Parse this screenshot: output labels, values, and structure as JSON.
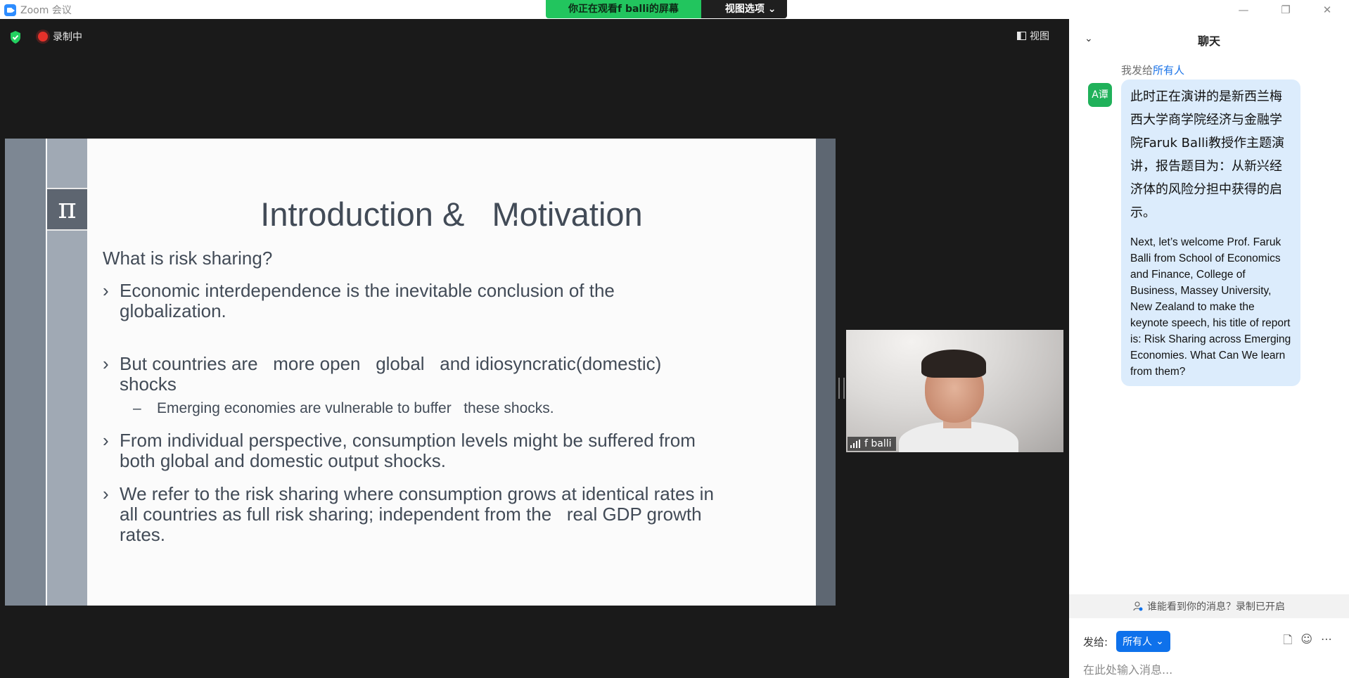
{
  "window": {
    "title": "Zoom 会议"
  },
  "share_banner": {
    "status": "你正在观看f balli的屏幕",
    "view_options": "视图选项"
  },
  "toolbar": {
    "recording": "录制中",
    "view": "视图"
  },
  "slide": {
    "title": "Introduction &   Motivation",
    "question": "What is risk sharing?",
    "bullets": [
      "Economic interdependence is the inevitable conclusion of the\nglobalization.",
      "But countries are   more open   global   and idiosyncratic(domestic)\nshocks",
      "From individual perspective, consumption levels might be suffered from\nboth global and domestic output shocks.",
      "We refer to the risk sharing where consumption grows at identical rates in\nall countries as full risk sharing; independent from the   real GDP growth\nrates."
    ],
    "sub_bullet": "Emerging economies are vulnerable to buffer   these shocks."
  },
  "video": {
    "participant_name": "f balli"
  },
  "chat": {
    "title": "聊天",
    "meta_prefix": "我发给",
    "meta_target": "所有人",
    "avatar": "A谭",
    "message_zh": "此时正在演讲的是新西兰梅西大学商学院经济与金融学院Faruk Balli教授作主题演讲，报告题目为：从新兴经济体的风险分担中获得的启示。",
    "message_en": "Next, let’s welcome Prof. Faruk Balli from School of Economics and Finance, College of Business, Massey University, New Zealand to make the keynote speech, his title of report is: Risk Sharing across Emerging Economies. What Can We learn from them?",
    "notice": "谁能看到你的消息？录制已开启",
    "send_label": "发给:",
    "send_target": "所有人",
    "input_placeholder": "在此处输入消息..."
  },
  "colors": {
    "zoom_blue": "#0e71eb",
    "banner_green": "#22c55e",
    "record_red": "#e5312a",
    "bubble": "#dcecfc"
  }
}
